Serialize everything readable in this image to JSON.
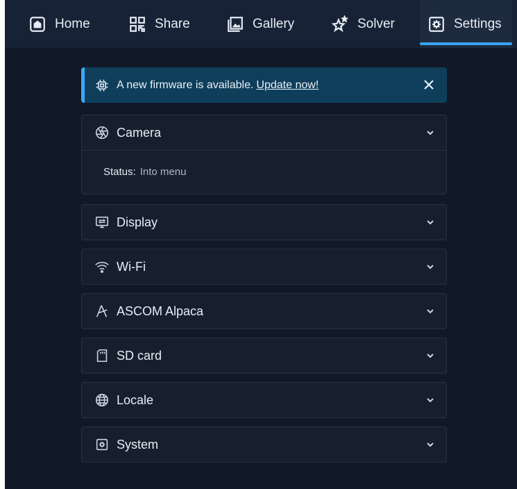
{
  "nav": {
    "items": [
      {
        "label": "Home",
        "icon": "home-icon"
      },
      {
        "label": "Share",
        "icon": "qr-code-icon"
      },
      {
        "label": "Gallery",
        "icon": "gallery-icon"
      },
      {
        "label": "Solver",
        "icon": "stars-icon"
      },
      {
        "label": "Settings",
        "icon": "settings-icon",
        "active": true
      }
    ]
  },
  "alert": {
    "message": "A new firmware is available.",
    "link": "Update now!",
    "icon": "chip-icon"
  },
  "sections": [
    {
      "title": "Camera",
      "icon": "aperture-icon",
      "expanded": true,
      "status_label": "Status:",
      "status_value": "Into menu"
    },
    {
      "title": "Display",
      "icon": "display-icon"
    },
    {
      "title": "Wi-Fi",
      "icon": "wifi-icon"
    },
    {
      "title": "ASCOM Alpaca",
      "icon": "telescope-icon"
    },
    {
      "title": "SD card",
      "icon": "sd-card-icon"
    },
    {
      "title": "Locale",
      "icon": "globe-icon"
    },
    {
      "title": "System",
      "icon": "system-icon"
    }
  ],
  "colors": {
    "background": "#111827",
    "nav_background": "#172236",
    "accent": "#39a3f5",
    "alert_background": "#0f3e5b",
    "panel_background": "#171f2e"
  }
}
